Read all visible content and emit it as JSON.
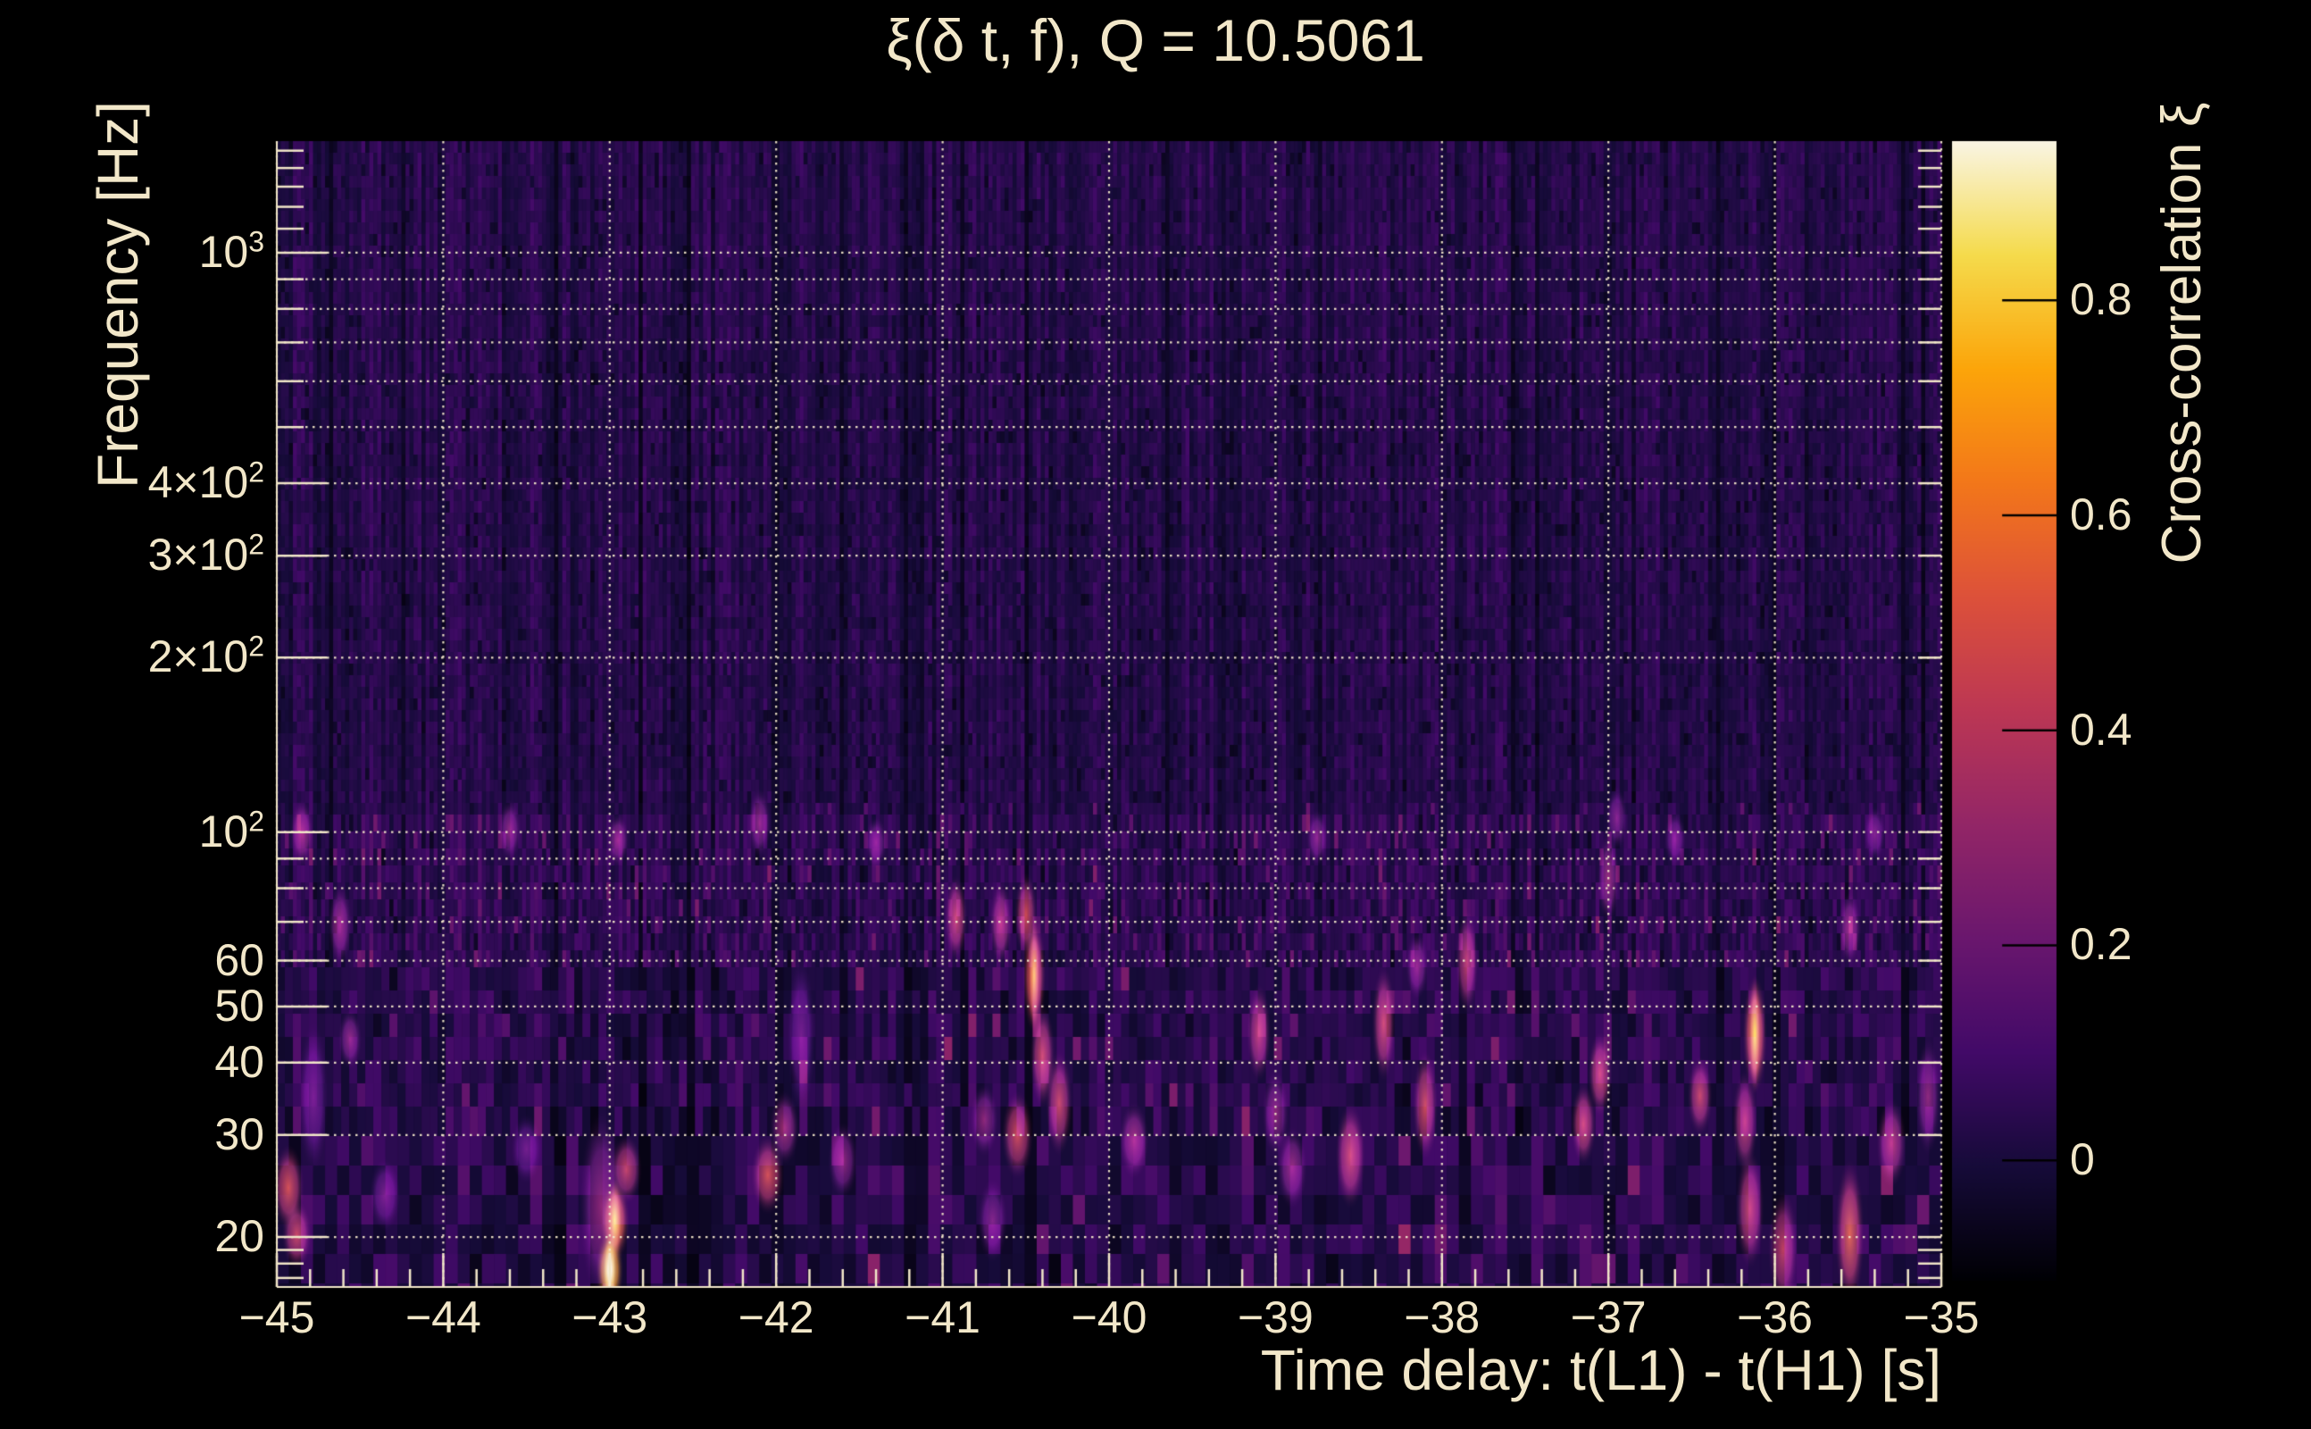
{
  "title": "ξ(δ t, f), Q = 10.5061",
  "colors": {
    "background": "#000000",
    "text": "#f2e7c9",
    "grid": "#f2e7c9",
    "axis": "#f2e7c9",
    "colorbar_tick": "#000000"
  },
  "chart_data": {
    "type": "heatmap",
    "title": "ξ(δ t, f), Q = 10.5061",
    "xlabel": "Time delay: t(L1) - t(H1) [s]",
    "ylabel": "Frequency [Hz]",
    "colorbar_label": "Cross-correlation ξ",
    "x_range": [
      -45,
      -35
    ],
    "y_range_hz": [
      16.4,
      1558
    ],
    "y_scale": "log10",
    "grid": "dotted",
    "color_range": [
      -0.112,
      0.948
    ],
    "x_ticks": [
      {
        "value": -45,
        "label": "−45"
      },
      {
        "value": -44,
        "label": "−44"
      },
      {
        "value": -43,
        "label": "−43"
      },
      {
        "value": -42,
        "label": "−42"
      },
      {
        "value": -41,
        "label": "−41"
      },
      {
        "value": -40,
        "label": "−40"
      },
      {
        "value": -39,
        "label": "−39"
      },
      {
        "value": -38,
        "label": "−38"
      },
      {
        "value": -37,
        "label": "−37"
      },
      {
        "value": -36,
        "label": "−36"
      },
      {
        "value": -35,
        "label": "−35"
      }
    ],
    "x_minor_tick_step": 0.2,
    "y_ticks": [
      {
        "f": 1000,
        "base": "10",
        "sup": "3"
      },
      {
        "f": 400,
        "base": "4×10",
        "sup": "2"
      },
      {
        "f": 300,
        "base": "3×10",
        "sup": "2"
      },
      {
        "f": 200,
        "base": "2×10",
        "sup": "2"
      },
      {
        "f": 100,
        "base": "10",
        "sup": "2"
      },
      {
        "f": 60,
        "base": "60",
        "sup": ""
      },
      {
        "f": 50,
        "base": "50",
        "sup": ""
      },
      {
        "f": 40,
        "base": "40",
        "sup": ""
      },
      {
        "f": 30,
        "base": "30",
        "sup": ""
      },
      {
        "f": 20,
        "base": "20",
        "sup": ""
      }
    ],
    "y_gridlines_hz": [
      20,
      30,
      40,
      50,
      60,
      70,
      80,
      90,
      100,
      200,
      300,
      400,
      500,
      600,
      700,
      800,
      900,
      1000
    ],
    "y_minor_ticks_hz": [
      17,
      18,
      19,
      1100,
      1200,
      1300,
      1400,
      1500
    ],
    "colorbar_ticks": [
      {
        "v": 0.8,
        "label": "0.8"
      },
      {
        "v": 0.6,
        "label": "0.6"
      },
      {
        "v": 0.4,
        "label": "0.4"
      },
      {
        "v": 0.2,
        "label": "0.2"
      },
      {
        "v": 0.0,
        "label": "0"
      }
    ],
    "colormap": {
      "name": "inferno",
      "stops": [
        [
          0.0,
          "#000004"
        ],
        [
          0.1,
          "#160b39"
        ],
        [
          0.2,
          "#420a68"
        ],
        [
          0.3,
          "#6a176e"
        ],
        [
          0.4,
          "#932667"
        ],
        [
          0.5,
          "#bc3754"
        ],
        [
          0.6,
          "#dd513a"
        ],
        [
          0.7,
          "#f3771a"
        ],
        [
          0.8,
          "#fca50a"
        ],
        [
          0.9,
          "#f5db4c"
        ],
        [
          1.0,
          "#faf5e4"
        ]
      ]
    },
    "noise_seed": 9873,
    "hotspots": [
      {
        "t": -44.93,
        "f1": 21.5,
        "f2": 27.5,
        "xi": 0.52,
        "w": 0.1
      },
      {
        "t": -44.88,
        "f1": 18.5,
        "f2": 22.0,
        "xi": 0.48,
        "w": 0.09
      },
      {
        "t": -44.78,
        "f1": 27.0,
        "f2": 45.0,
        "xi": 0.2,
        "w": 0.09
      },
      {
        "t": -44.85,
        "f1": 92.0,
        "f2": 108.0,
        "xi": 0.36,
        "w": 0.05
      },
      {
        "t": -44.62,
        "f1": 62.0,
        "f2": 77.0,
        "xi": 0.33,
        "w": 0.05
      },
      {
        "t": -44.56,
        "f1": 41.0,
        "f2": 47.0,
        "xi": 0.3,
        "w": 0.05
      },
      {
        "t": -44.35,
        "f1": 21.5,
        "f2": 26.0,
        "xi": 0.22,
        "w": 0.1
      },
      {
        "t": -43.6,
        "f1": 94.0,
        "f2": 108.0,
        "xi": 0.3,
        "w": 0.045
      },
      {
        "t": -43.5,
        "f1": 26.0,
        "f2": 31.0,
        "xi": 0.2,
        "w": 0.1
      },
      {
        "t": -43.0,
        "f1": 15.8,
        "f2": 19.5,
        "xi": 0.95,
        "w": 0.075
      },
      {
        "t": -42.97,
        "f1": 19.0,
        "f2": 24.0,
        "xi": 0.72,
        "w": 0.09
      },
      {
        "t": -42.9,
        "f1": 24.0,
        "f2": 28.5,
        "xi": 0.46,
        "w": 0.1
      },
      {
        "t": -43.05,
        "f1": 16.0,
        "f2": 32.0,
        "xi": 0.3,
        "w": 0.18
      },
      {
        "t": -42.95,
        "f1": 92.0,
        "f2": 102.0,
        "xi": 0.32,
        "w": 0.04
      },
      {
        "t": -42.05,
        "f1": 23.0,
        "f2": 28.5,
        "xi": 0.52,
        "w": 0.11
      },
      {
        "t": -41.95,
        "f1": 28.0,
        "f2": 34.0,
        "xi": 0.35,
        "w": 0.09
      },
      {
        "t": -41.85,
        "f1": 34.0,
        "f2": 58.0,
        "xi": 0.2,
        "w": 0.08
      },
      {
        "t": -42.1,
        "f1": 95.0,
        "f2": 113.0,
        "xi": 0.3,
        "w": 0.045
      },
      {
        "t": -41.6,
        "f1": 24.5,
        "f2": 30.0,
        "xi": 0.3,
        "w": 0.09
      },
      {
        "t": -41.4,
        "f1": 91.0,
        "f2": 101.0,
        "xi": 0.27,
        "w": 0.04
      },
      {
        "t": -40.92,
        "f1": 63.0,
        "f2": 80.0,
        "xi": 0.48,
        "w": 0.045
      },
      {
        "t": -40.65,
        "f1": 62.0,
        "f2": 78.0,
        "xi": 0.42,
        "w": 0.045
      },
      {
        "t": -40.5,
        "f1": 64.0,
        "f2": 81.0,
        "xi": 0.5,
        "w": 0.045
      },
      {
        "t": -40.45,
        "f1": 47.0,
        "f2": 68.0,
        "xi": 0.63,
        "w": 0.05
      },
      {
        "t": -40.4,
        "f1": 35.0,
        "f2": 48.0,
        "xi": 0.5,
        "w": 0.06
      },
      {
        "t": -40.3,
        "f1": 29.0,
        "f2": 40.0,
        "xi": 0.48,
        "w": 0.07
      },
      {
        "t": -40.55,
        "f1": 26.5,
        "f2": 34.0,
        "xi": 0.5,
        "w": 0.1
      },
      {
        "t": -40.75,
        "f1": 29.0,
        "f2": 35.0,
        "xi": 0.3,
        "w": 0.08
      },
      {
        "t": -40.7,
        "f1": 19.0,
        "f2": 24.0,
        "xi": 0.25,
        "w": 0.09
      },
      {
        "t": -39.85,
        "f1": 26.5,
        "f2": 32.5,
        "xi": 0.35,
        "w": 0.09
      },
      {
        "t": -39.1,
        "f1": 39.0,
        "f2": 52.0,
        "xi": 0.45,
        "w": 0.055
      },
      {
        "t": -39.0,
        "f1": 29.0,
        "f2": 37.0,
        "xi": 0.3,
        "w": 0.07
      },
      {
        "t": -38.9,
        "f1": 23.5,
        "f2": 29.5,
        "xi": 0.32,
        "w": 0.09
      },
      {
        "t": -38.55,
        "f1": 23.5,
        "f2": 32.5,
        "xi": 0.5,
        "w": 0.09
      },
      {
        "t": -38.35,
        "f1": 39.0,
        "f2": 56.0,
        "xi": 0.5,
        "w": 0.05
      },
      {
        "t": -38.1,
        "f1": 28.5,
        "f2": 40.0,
        "xi": 0.5,
        "w": 0.06
      },
      {
        "t": -38.15,
        "f1": 54.0,
        "f2": 64.0,
        "xi": 0.3,
        "w": 0.045
      },
      {
        "t": -38.75,
        "f1": 92.0,
        "f2": 104.0,
        "xi": 0.27,
        "w": 0.04
      },
      {
        "t": -37.85,
        "f1": 51.0,
        "f2": 70.0,
        "xi": 0.45,
        "w": 0.045
      },
      {
        "t": -37.15,
        "f1": 28.0,
        "f2": 35.0,
        "xi": 0.5,
        "w": 0.06
      },
      {
        "t": -37.05,
        "f1": 34.0,
        "f2": 43.0,
        "xi": 0.5,
        "w": 0.055
      },
      {
        "t": -37.0,
        "f1": 73.0,
        "f2": 95.0,
        "xi": 0.33,
        "w": 0.04
      },
      {
        "t": -36.95,
        "f1": 98.0,
        "f2": 114.0,
        "xi": 0.25,
        "w": 0.04
      },
      {
        "t": -36.6,
        "f1": 92.0,
        "f2": 103.0,
        "xi": 0.24,
        "w": 0.04
      },
      {
        "t": -36.45,
        "f1": 31.5,
        "f2": 39.0,
        "xi": 0.48,
        "w": 0.06
      },
      {
        "t": -36.12,
        "f1": 37.0,
        "f2": 54.0,
        "xi": 0.7,
        "w": 0.055
      },
      {
        "t": -36.18,
        "f1": 27.0,
        "f2": 37.0,
        "xi": 0.45,
        "w": 0.06
      },
      {
        "t": -36.15,
        "f1": 18.5,
        "f2": 27.0,
        "xi": 0.48,
        "w": 0.08
      },
      {
        "t": -35.95,
        "f1": 15.8,
        "f2": 23.0,
        "xi": 0.45,
        "w": 0.09
      },
      {
        "t": -35.55,
        "f1": 15.8,
        "f2": 26.0,
        "xi": 0.58,
        "w": 0.085
      },
      {
        "t": -35.55,
        "f1": 62.0,
        "f2": 75.0,
        "xi": 0.33,
        "w": 0.045
      },
      {
        "t": -35.4,
        "f1": 94.0,
        "f2": 105.0,
        "xi": 0.24,
        "w": 0.04
      },
      {
        "t": -35.3,
        "f1": 25.5,
        "f2": 33.0,
        "xi": 0.42,
        "w": 0.09
      },
      {
        "t": -35.08,
        "f1": 29.0,
        "f2": 42.0,
        "xi": 0.3,
        "w": 0.06
      }
    ]
  }
}
